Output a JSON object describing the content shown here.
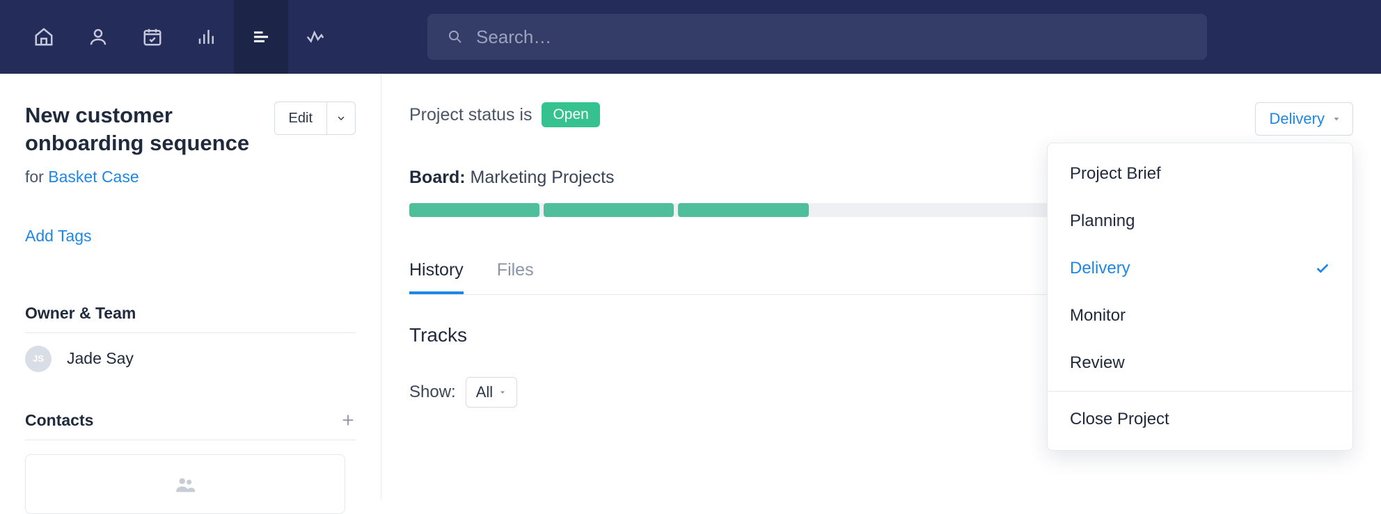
{
  "search": {
    "placeholder": "Search…"
  },
  "sidebar": {
    "title": "New customer onboarding sequence",
    "for_prefix": "for ",
    "for_link": "Basket Case",
    "edit_label": "Edit",
    "add_tags": "Add Tags",
    "owner_section": "Owner & Team",
    "owner": {
      "initials": "JS",
      "name": "Jade Say"
    },
    "contacts_section": "Contacts"
  },
  "content": {
    "status_prefix": "Project status is",
    "status_value": "Open",
    "board_label": "Board:",
    "board_name": "Marketing Projects",
    "tabs": {
      "history": "History",
      "files": "Files"
    },
    "tracks_heading": "Tracks",
    "show_label": "Show:",
    "show_value": "All",
    "stage_button": "Delivery",
    "stage_menu": {
      "items": [
        {
          "label": "Project Brief"
        },
        {
          "label": "Planning"
        },
        {
          "label": "Delivery",
          "selected": true
        },
        {
          "label": "Monitor"
        },
        {
          "label": "Review"
        }
      ],
      "footer": "Close Project",
      "selected_label": "Delivery"
    }
  }
}
